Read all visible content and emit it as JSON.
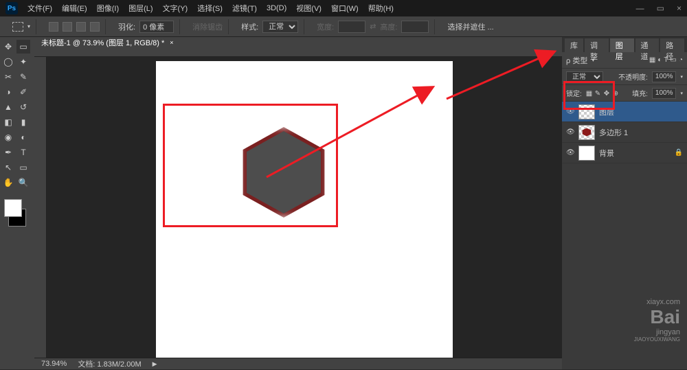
{
  "app": {
    "logo": "Ps"
  },
  "menu": [
    "文件(F)",
    "编辑(E)",
    "图像(I)",
    "图层(L)",
    "文字(Y)",
    "选择(S)",
    "滤镜(T)",
    "3D(D)",
    "视图(V)",
    "窗口(W)",
    "帮助(H)"
  ],
  "window_controls": [
    "—",
    "▭",
    "×"
  ],
  "options_bar": {
    "feather_label": "羽化:",
    "feather_value": "0 像素",
    "antialias": "消除锯齿",
    "style_label": "样式:",
    "style_value": "正常",
    "width_label": "宽度:",
    "height_label": "高度:",
    "refine": "选择并遮住 ..."
  },
  "document": {
    "tab_title": "未标题-1 @ 73.9% (图层 1, RGB/8) *"
  },
  "panels": {
    "top_tabs": [
      "库",
      "调整",
      "图层",
      "通道",
      "路径"
    ],
    "active_top_tab": "图层",
    "filter_label": "ρ 类型",
    "blend_mode": "正常",
    "opacity_label": "不透明度:",
    "opacity_value": "100%",
    "lock_label": "锁定:",
    "fill_label": "填充:",
    "fill_value": "100%",
    "lock_icons": [
      "▦",
      "✎",
      "✥",
      "⊕"
    ],
    "filter_icons": [
      "▦",
      "◐",
      "T",
      "▭",
      "◔"
    ]
  },
  "layers": [
    {
      "name": "图层",
      "selected": true,
      "thumb": "checker"
    },
    {
      "name": "多边形 1",
      "selected": false,
      "thumb": "checker-red"
    },
    {
      "name": "背景",
      "selected": false,
      "thumb": "white",
      "locked": true
    }
  ],
  "status": {
    "zoom": "73.94%",
    "doc_info": "文档: 1.83M/2.00M"
  },
  "watermark": {
    "url": "xiayx.com",
    "brand": "Bai",
    "sub": "jingyan",
    "org": "JIAOYOUXIWANG"
  }
}
